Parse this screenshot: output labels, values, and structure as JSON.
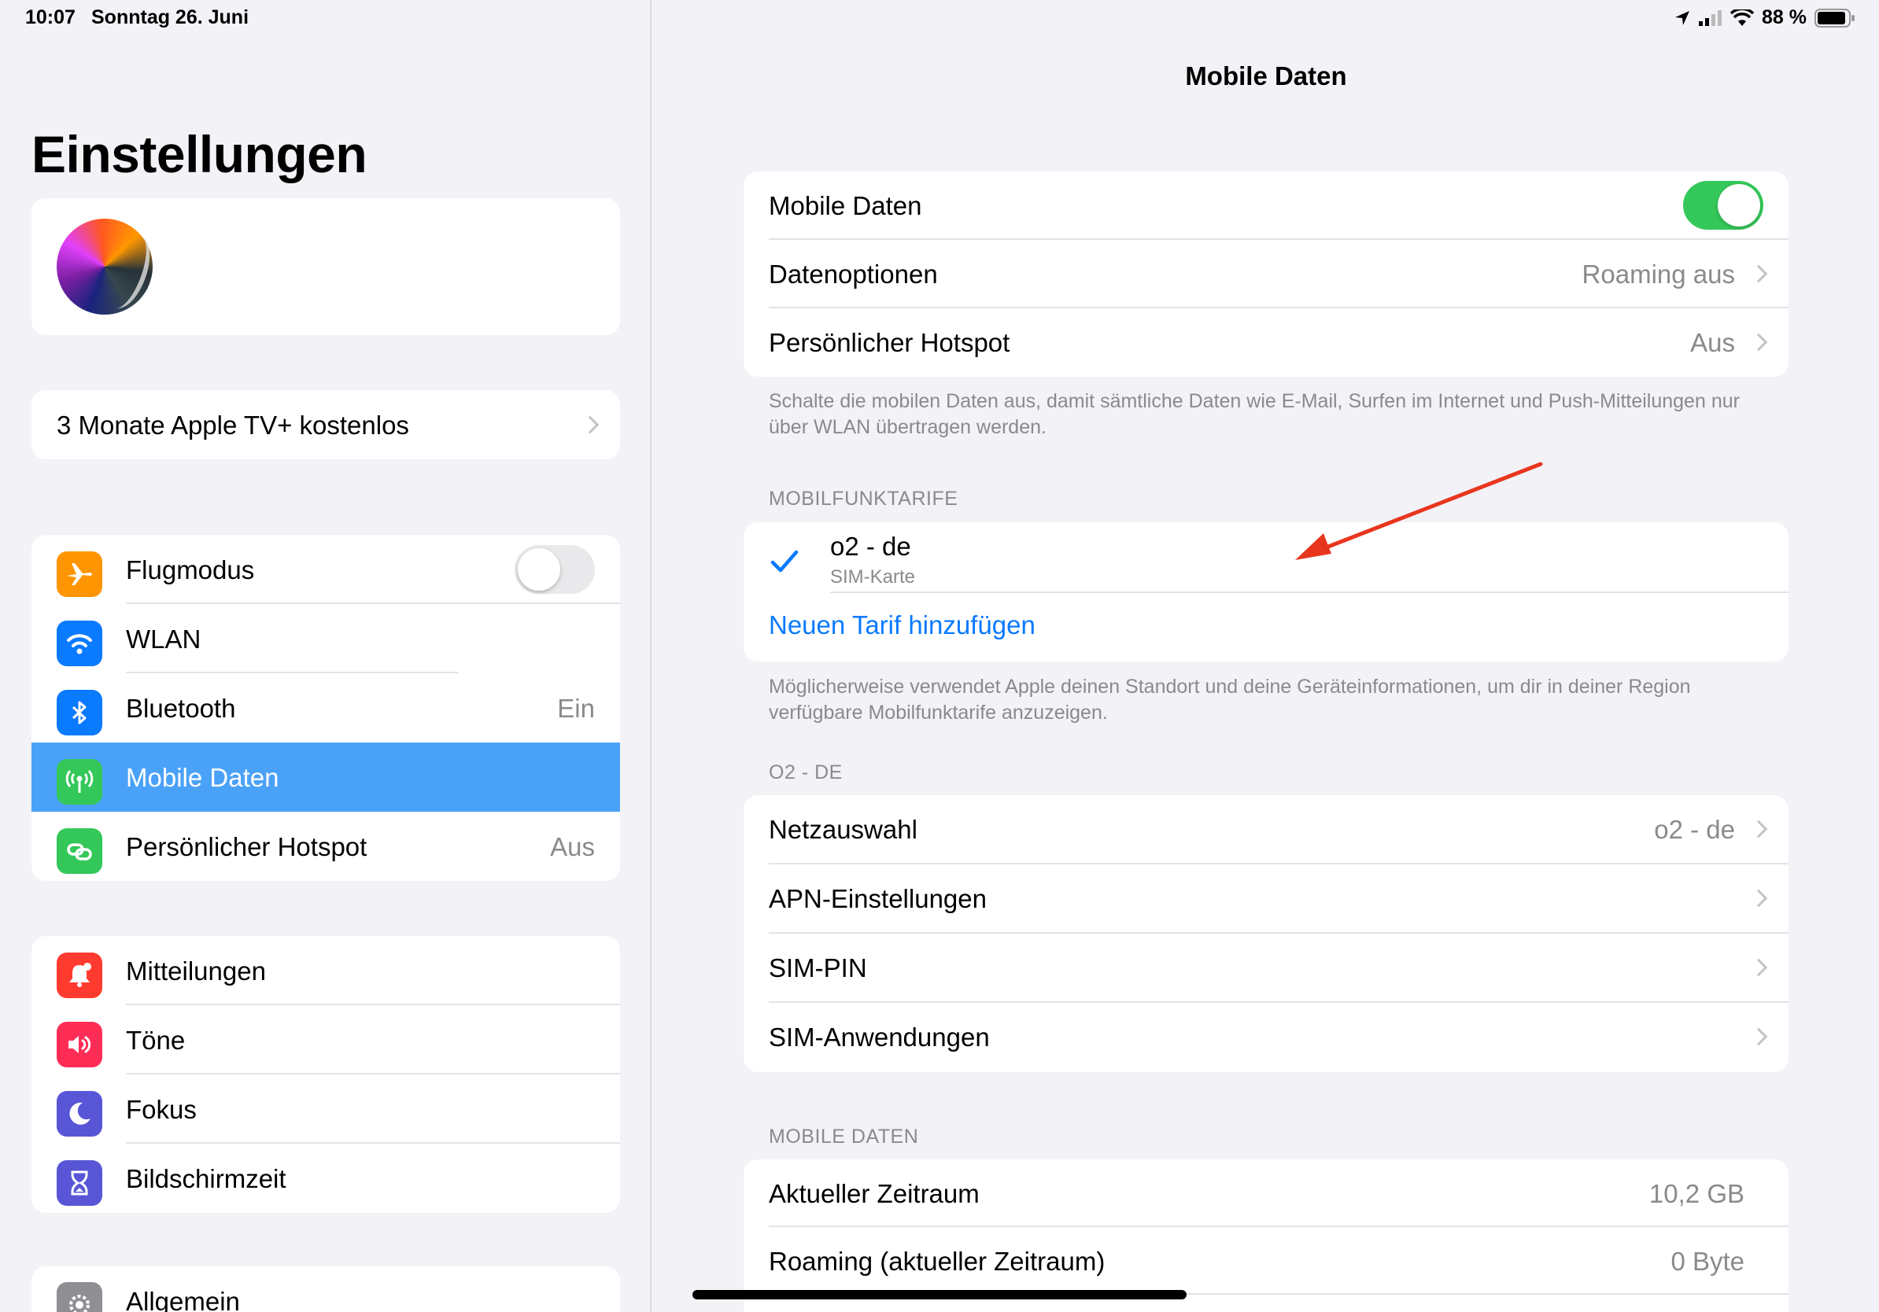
{
  "status": {
    "time": "10:07",
    "date": "Sonntag 26. Juni",
    "battery": "88 %"
  },
  "left": {
    "title": "Einstellungen",
    "promo": "3 Monate Apple TV+ kostenlos",
    "group1": [
      {
        "label": "Flugmodus",
        "icon": "airplane-icon",
        "color": "#ff9500"
      },
      {
        "label": "WLAN",
        "icon": "wifi-icon",
        "color": "#0a7aff"
      },
      {
        "label": "Bluetooth",
        "icon": "bluetooth-icon",
        "color": "#0a7aff",
        "value": "Ein"
      },
      {
        "label": "Mobile Daten",
        "icon": "antenna-icon",
        "color": "#34c759"
      },
      {
        "label": "Persönlicher Hotspot",
        "icon": "hotspot-icon",
        "color": "#34c759",
        "value": "Aus"
      }
    ],
    "group2": [
      {
        "label": "Mitteilungen",
        "icon": "bell-icon",
        "color": "#ff3b30"
      },
      {
        "label": "Töne",
        "icon": "speaker-icon",
        "color": "#ff2d55"
      },
      {
        "label": "Fokus",
        "icon": "moon-icon",
        "color": "#5856d6"
      },
      {
        "label": "Bildschirmzeit",
        "icon": "hourglass-icon",
        "color": "#5856d6"
      }
    ],
    "group3": [
      {
        "label": "Allgemein",
        "icon": "gear-icon",
        "color": "#8e8e93"
      }
    ]
  },
  "right": {
    "nav_title": "Mobile Daten",
    "main": [
      {
        "label": "Mobile Daten"
      },
      {
        "label": "Datenoptionen",
        "value": "Roaming aus"
      },
      {
        "label": "Persönlicher Hotspot",
        "value": "Aus"
      }
    ],
    "footnote1": "Schalte die mobilen Daten aus, damit sämtliche Daten wie E-Mail, Surfen im Internet und Push-Mitteilungen nur über WLAN übertragen werden.",
    "section_tarife": "MOBILFUNKTARIFE",
    "tarif_name": "o2 - de",
    "tarif_sub": "SIM-Karte",
    "add_tarif": "Neuen Tarif hinzufügen",
    "footnote2": "Möglicherweise verwendet Apple deinen Standort und deine Geräteinformationen, um dir in deiner Region verfügbare Mobilfunktarife anzuzeigen.",
    "section_o2": "O2 - DE",
    "o2": [
      {
        "label": "Netzauswahl",
        "value": "o2 - de"
      },
      {
        "label": "APN-Einstellungen"
      },
      {
        "label": "SIM-PIN"
      },
      {
        "label": "SIM-Anwendungen"
      }
    ],
    "section_usage": "MOBILE DATEN",
    "usage": [
      {
        "label": "Aktueller Zeitraum",
        "value": "10,2 GB"
      },
      {
        "label": "Roaming (aktueller Zeitraum)",
        "value": "0 Byte"
      }
    ]
  }
}
